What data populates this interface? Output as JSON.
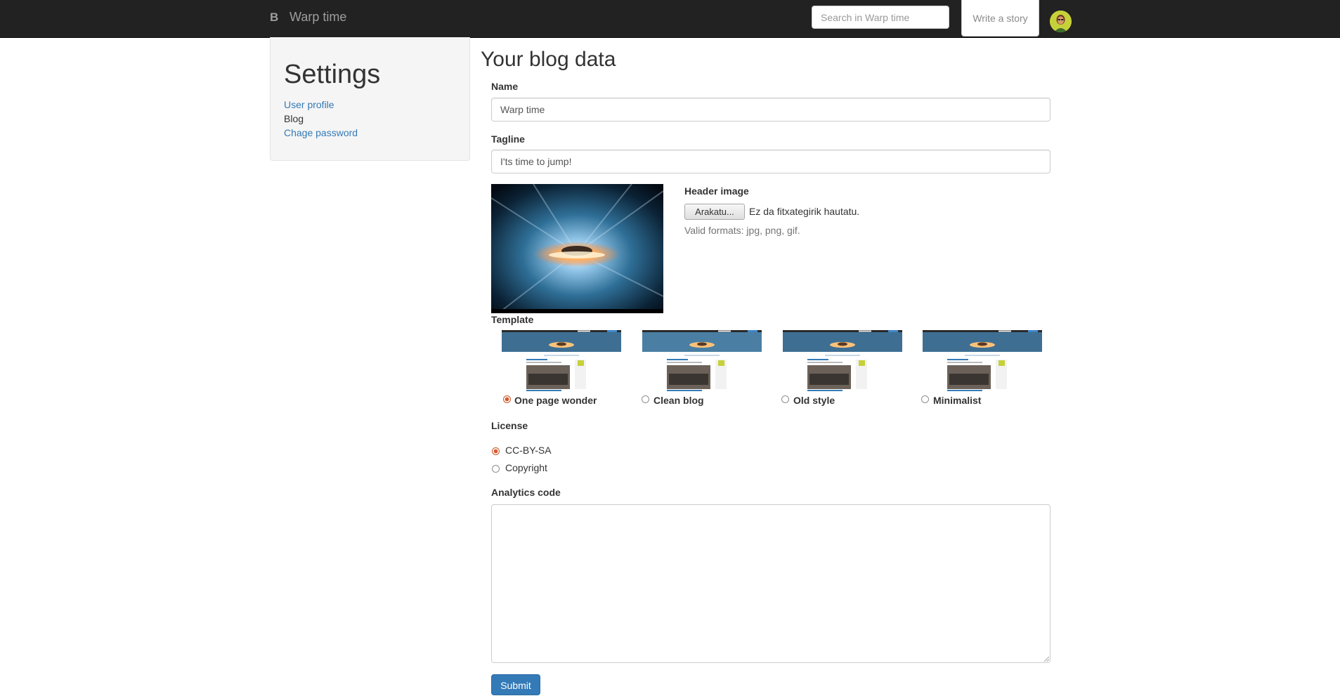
{
  "navbar": {
    "brand_mark": "B",
    "brand_name": "Warp time",
    "search_placeholder": "Search in Warp time",
    "write_story_label": "Write a story"
  },
  "sidebar": {
    "title": "Settings",
    "links": [
      {
        "label": "User profile",
        "active": false
      },
      {
        "label": "Blog",
        "active": true
      },
      {
        "label": "Chage password",
        "active": false
      }
    ]
  },
  "form": {
    "title": "Your blog data",
    "name_label": "Name",
    "name_value": "Warp time",
    "tagline_label": "Tagline",
    "tagline_value": "I'ts time to jump!",
    "header_image_label": "Header image",
    "file_button_label": "Arakatu...",
    "file_status": "Ez da fitxategirik hautatu.",
    "file_help": "Valid formats: jpg, png, gif.",
    "template_label": "Template",
    "templates": [
      {
        "label": "One page wonder",
        "selected": true
      },
      {
        "label": "Clean blog",
        "selected": false
      },
      {
        "label": "Old style",
        "selected": false
      },
      {
        "label": "Minimalist",
        "selected": false
      }
    ],
    "license_label": "License",
    "licenses": [
      {
        "label": "CC-BY-SA",
        "selected": true
      },
      {
        "label": "Copyright",
        "selected": false
      }
    ],
    "analytics_label": "Analytics code",
    "analytics_value": "",
    "submit_label": "Submit"
  },
  "colors": {
    "navbar_bg": "#222222",
    "link": "#337ab7",
    "primary_button": "#337ab7",
    "radio_selected": "#d9582b"
  }
}
